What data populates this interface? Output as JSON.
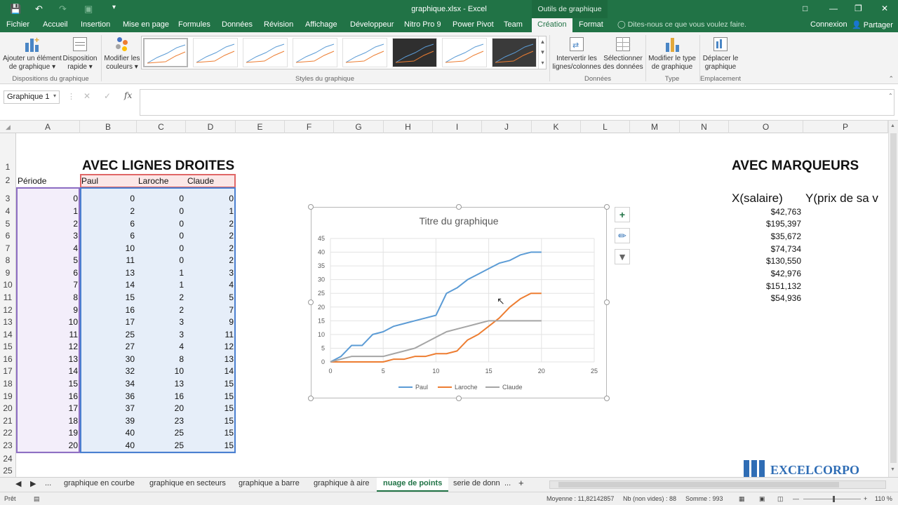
{
  "titlebar": {
    "doc_title": "graphique.xlsx - Excel",
    "context_title": "Outils de graphique"
  },
  "tabs": [
    "Fichier",
    "Accueil",
    "Insertion",
    "Mise en page",
    "Formules",
    "Données",
    "Révision",
    "Affichage",
    "Développeur",
    "Nitro Pro 9",
    "Power Pivot",
    "Team",
    "Création",
    "Format"
  ],
  "tellme": "Dites-nous ce que vous voulez faire.",
  "account": {
    "signin": "Connexion",
    "share": "Partager"
  },
  "ribbon": {
    "add_element": [
      "Ajouter un élément",
      "de graphique ▾"
    ],
    "quick_layout": [
      "Disposition",
      "rapide ▾"
    ],
    "colors": [
      "Modifier les",
      "couleurs ▾"
    ],
    "switch": [
      "Intervertir les",
      "lignes/colonnes"
    ],
    "select_data": [
      "Sélectionner",
      "des données"
    ],
    "change_type": [
      "Modifier le type",
      "de graphique"
    ],
    "move": [
      "Déplacer le",
      "graphique"
    ],
    "groups": {
      "layouts": "Dispositions du graphique",
      "styles": "Styles du graphique",
      "data": "Données",
      "type": "Type",
      "location": "Emplacement"
    }
  },
  "namebox": "Graphique 1",
  "columns": [
    "A",
    "B",
    "C",
    "D",
    "E",
    "F",
    "G",
    "H",
    "I",
    "J",
    "K",
    "L",
    "M",
    "N",
    "O",
    "P"
  ],
  "rows": [
    "1",
    "2",
    "3",
    "4",
    "5",
    "6",
    "7",
    "8",
    "9",
    "10",
    "11",
    "12",
    "13",
    "14",
    "15",
    "16",
    "17",
    "18",
    "19",
    "20",
    "21",
    "22",
    "23",
    "24",
    "25"
  ],
  "sheet": {
    "title_left": "AVEC LIGNES DROITES",
    "title_right": "AVEC MARQUEURS",
    "headers": [
      "Période",
      "Paul",
      "Laroche",
      "Claude"
    ],
    "data": [
      [
        0,
        0,
        0,
        0
      ],
      [
        1,
        2,
        0,
        1
      ],
      [
        2,
        6,
        0,
        2
      ],
      [
        3,
        6,
        0,
        2
      ],
      [
        4,
        10,
        0,
        2
      ],
      [
        5,
        11,
        0,
        2
      ],
      [
        6,
        13,
        1,
        3
      ],
      [
        7,
        14,
        1,
        4
      ],
      [
        8,
        15,
        2,
        5
      ],
      [
        9,
        16,
        2,
        7
      ],
      [
        10,
        17,
        3,
        9
      ],
      [
        11,
        25,
        3,
        11
      ],
      [
        12,
        27,
        4,
        12
      ],
      [
        13,
        30,
        8,
        13
      ],
      [
        14,
        32,
        10,
        14
      ],
      [
        15,
        34,
        13,
        15
      ],
      [
        16,
        36,
        16,
        15
      ],
      [
        17,
        37,
        20,
        15
      ],
      [
        18,
        39,
        23,
        15
      ],
      [
        19,
        40,
        25,
        15
      ],
      [
        20,
        40,
        25,
        15
      ]
    ],
    "right_headers": [
      "X(salaire)",
      "Y(prix de sa v"
    ],
    "salaries": [
      "$42,763",
      "$195,397",
      "$35,672",
      "$74,734",
      "$130,550",
      "$42,976",
      "$151,132",
      "$54,936"
    ]
  },
  "chart_data": {
    "type": "line",
    "title": "Titre du graphique",
    "x": [
      0,
      1,
      2,
      3,
      4,
      5,
      6,
      7,
      8,
      9,
      10,
      11,
      12,
      13,
      14,
      15,
      16,
      17,
      18,
      19,
      20
    ],
    "series": [
      {
        "name": "Paul",
        "color": "#5b9bd5",
        "values": [
          0,
          2,
          6,
          6,
          10,
          11,
          13,
          14,
          15,
          16,
          17,
          25,
          27,
          30,
          32,
          34,
          36,
          37,
          39,
          40,
          40
        ]
      },
      {
        "name": "Laroche",
        "color": "#ed7d31",
        "values": [
          0,
          0,
          0,
          0,
          0,
          0,
          1,
          1,
          2,
          2,
          3,
          3,
          4,
          8,
          10,
          13,
          16,
          20,
          23,
          25,
          25
        ]
      },
      {
        "name": "Claude",
        "color": "#a5a5a5",
        "values": [
          0,
          1,
          2,
          2,
          2,
          2,
          3,
          4,
          5,
          7,
          9,
          11,
          12,
          13,
          14,
          15,
          15,
          15,
          15,
          15,
          15
        ]
      }
    ],
    "xlim": [
      0,
      25
    ],
    "ylim": [
      0,
      45
    ],
    "xticks": [
      "0",
      "5",
      "10",
      "15",
      "20",
      "25"
    ],
    "yticks": [
      "0",
      "5",
      "10",
      "15",
      "20",
      "25",
      "30",
      "35",
      "40",
      "45"
    ],
    "grid": true,
    "legend": "bottom"
  },
  "sheet_tabs": [
    "◀",
    "▶",
    "...",
    "graphique en courbe",
    "graphique en secteurs",
    "graphique a barre",
    "graphique à aire",
    "nuage de points",
    "serie de donn",
    "...",
    "+"
  ],
  "status": {
    "ready": "Prêt",
    "average": "Moyenne : 11,82142857",
    "count": "Nb (non vides) : 88",
    "sum": "Somme : 993",
    "zoom": "110 %"
  },
  "watermark": "EXCELCORPO",
  "colors": {
    "excel_green": "#217346",
    "paul": "#5b9bd5",
    "laroche": "#ed7d31",
    "claude": "#a5a5a5"
  }
}
